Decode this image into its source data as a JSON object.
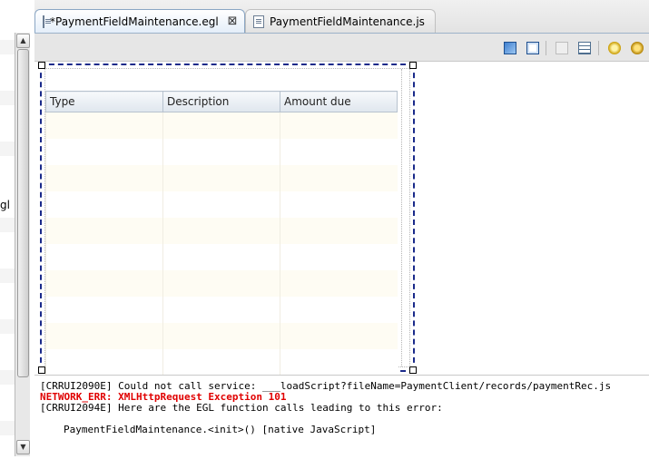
{
  "left_panel": {
    "text_fragment": "gl"
  },
  "tabs": [
    {
      "label": "*PaymentFieldMaintenance.egl",
      "active": true,
      "close": "⊠"
    },
    {
      "label": "PaymentFieldMaintenance.js",
      "active": false
    }
  ],
  "toolbar": {
    "icons": [
      "preview-layout-icon",
      "design-frame-icon",
      "disabled-action-icon",
      "properties-list-icon",
      "run-gear-icon",
      "refresh-gear-icon"
    ]
  },
  "grid": {
    "columns": [
      "Type",
      "Description",
      "Amount due"
    ],
    "empty_rows": 10
  },
  "console": {
    "line1": "[CRRUI2090E] Could not call service: ___loadScript?fileName=PaymentClient/records/paymentRec.js",
    "line2": "NETWORK_ERR: XMLHttpRequest Exception 101",
    "line3": "[CRRUI2094E] Here are the EGL function calls leading to this error:",
    "line4": "PaymentFieldMaintenance.<init>() [native JavaScript]"
  },
  "colors": {
    "error_text": "#e00000",
    "selection_border": "#1a2a8a",
    "active_tab": "#e4eef9"
  }
}
